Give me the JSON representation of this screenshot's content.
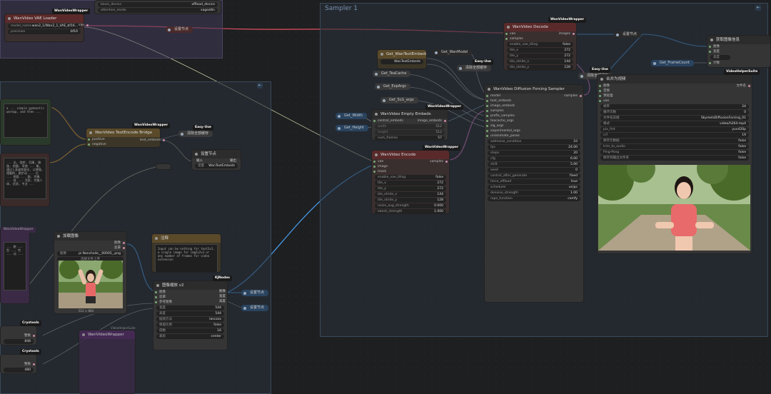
{
  "groups": {
    "sampler": "Sampler 1"
  },
  "top": {
    "block_device": "block_device",
    "offload_device": "offload_device",
    "attention_mode": "attention_mode",
    "sageattn": "sageattn",
    "vae_loader_title": "WanVideo VAE Loader",
    "vae_badge": "WanVideoWrapper",
    "model_name": "model_name",
    "model_value": "wan2_1/Wan2_1_VAE_bf16...",
    "precision": "precision",
    "precision_value": "bf16",
    "vae": "vae",
    "set_node": "设置节点"
  },
  "left": {
    "prompt_text": "a ... simple gymnastic warmup, and then ...",
    "prompt_text_cn": "... 出, 绕转, 扫踢, 瑜伽, 抬腿, 弯曲 ... 躯, 通过上身姿势变化, 以增强, 摆腿的, 跑步动 ... 后 ... 侧面 ... 跑, 完美 ... 弧 ... 活跃, 完美人体, 优质, 专业 ...",
    "text_encode_title": "WanVideo TextEncode Bridge",
    "text_encode_badge": "WanVideoWrapper",
    "positive": "positive",
    "negative": "negative",
    "text_embeds": "text_embeds",
    "cleanup_title": "清除全部缓存",
    "easy_use": "Easy-Use",
    "set_node_title": "设置节点",
    "input": "输入",
    "output": "输出",
    "constant": "常量",
    "constant_value": "WanTextEmbeds",
    "wvw_small": "WanVideoWrapper",
    "load_image_title": "加载图像",
    "image": "图像",
    "mask": "遮罩",
    "image_label": "图像",
    "image_value": "pi Nanchaile__00005_.png",
    "upload": "选择文件上传",
    "image_size": "512 × 884",
    "note_title": "注释",
    "note_text": "Input can be nothing for text2v3, a single image for img2v2v3 or any number of frames for video extension",
    "resize_title": "图像缩放 v2",
    "kj_nodes": "KJNodes",
    "resize_rows": [
      [
        "宽度",
        "544"
      ],
      [
        "高度",
        "544"
      ],
      [
        "插值方法",
        "lanczos"
      ],
      [
        "保留比例",
        "false"
      ],
      [
        "倍数",
        "16"
      ],
      [
        "裁剪",
        "center"
      ]
    ],
    "resize_out": [
      "图像",
      "宽度",
      "高度"
    ],
    "resize_in": [
      "图像",
      "遮罩",
      "参考图像"
    ],
    "set1": "设置节点",
    "set2": "设置节点",
    "crystools": "Crystools",
    "int1": "整数",
    "int1_val": "848",
    "int2": "整数",
    "int2_val": "480",
    "purple_badge": "WanVideoWrapper",
    "purple_title": "WanVideoWrapper",
    "cn_text_left": "... 跑 ... 型 ... 完 ... 动 ...",
    "crystools_small": "VideoHelperSuite"
  },
  "sampler": {
    "get_text_embeds": "Get_WanTextEmbeds",
    "get_wan_model": "Get_WanModel",
    "text_embeds_val": "WanTextEmbeds",
    "get_tea_cache": "Get_TeaCache",
    "get_exp_args": "Get_ExpArgs",
    "get_slg_args": "Get_SLG_args",
    "get_width": "Get_Width",
    "get_height": "Get_Height",
    "cleanup": "清除全部缓存",
    "easy_use": "Easy-Use",
    "decode_title": "WanVideo Decode",
    "decode_badge": "WanVideoWrapper",
    "vae": "vae",
    "samples": "samples",
    "images": "images",
    "decode_rows": [
      [
        "enable_vae_tiling",
        "false"
      ],
      [
        "tile_x",
        "272"
      ],
      [
        "tile_y",
        "272"
      ],
      [
        "tile_stride_x",
        "144"
      ],
      [
        "tile_stride_y",
        "128"
      ]
    ],
    "empty_title": "WanVideo Empty Embeds",
    "empty_badge": "WanVideoWrapper",
    "control_embeds": "control_embeds",
    "image_embeds": "image_embeds",
    "empty_rows": [
      [
        "width",
        "512"
      ],
      [
        "height",
        "512"
      ],
      [
        "num_frames",
        "57"
      ]
    ],
    "encode_title": "WanVideo Encode",
    "encode_badge": "WanVideoWrapper",
    "image": "image",
    "mask": "mask",
    "encode_rows": [
      [
        "enable_vae_tiling",
        "false"
      ],
      [
        "tile_x",
        "272"
      ],
      [
        "tile_y",
        "272"
      ],
      [
        "tile_stride_x",
        "144"
      ],
      [
        "tile_stride_y",
        "128"
      ],
      [
        "noise_aug_strength",
        "0.000"
      ],
      [
        "latent_strength",
        "1.000"
      ]
    ],
    "dfs_title": "WanVideo Diffusion Forcing Sampler",
    "dfs_inputs": [
      "model",
      "text_embeds",
      "image_embeds",
      "samples",
      "prefix_samples",
      "teacache_args",
      "slg_args",
      "experimental_args",
      "unianimate_poses"
    ],
    "dfs_rows": [
      [
        "addnoise_condition",
        "10"
      ],
      [
        "fps",
        "24.00"
      ],
      [
        "steps",
        "20"
      ],
      [
        "cfg",
        "6.00"
      ],
      [
        "shift",
        "5.00"
      ],
      [
        "seed",
        "0"
      ],
      [
        "control_after_generate",
        "fixed"
      ],
      [
        "force_offload",
        "true"
      ],
      [
        "scheduler",
        "unipc"
      ],
      [
        "denoise_strength",
        "1.00"
      ],
      [
        "rope_function",
        "comfy"
      ]
    ],
    "set_node": "设置节点",
    "get_frame_count": "Get_FrameCount",
    "set_node2": "设置节点"
  },
  "right": {
    "get_info_title": "获取图像信息",
    "image": "图像",
    "width": "宽度",
    "height": "高度",
    "count": "计数",
    "vhs": "VideoHelperSuite",
    "combine_title": "合并为视频",
    "combine_in": [
      "图像",
      "音频",
      "预处理",
      "vae"
    ],
    "filename_label": "文件名",
    "combine_rows": [
      [
        "帧率",
        "24"
      ],
      [
        "循环次数",
        "0"
      ],
      [
        "文件名前缀",
        "SkyreelsDiffusionForcing_01"
      ],
      [
        "格式",
        "video/h264-mp4"
      ],
      [
        "pix_fmt",
        "yuv420p"
      ],
      [
        "crf",
        "19"
      ],
      [
        "保存元数据",
        "false"
      ],
      [
        "trim_to_audio",
        "false"
      ],
      [
        "Ping-Pong",
        "false"
      ],
      [
        "保存到输出文件夹",
        "false"
      ]
    ]
  }
}
